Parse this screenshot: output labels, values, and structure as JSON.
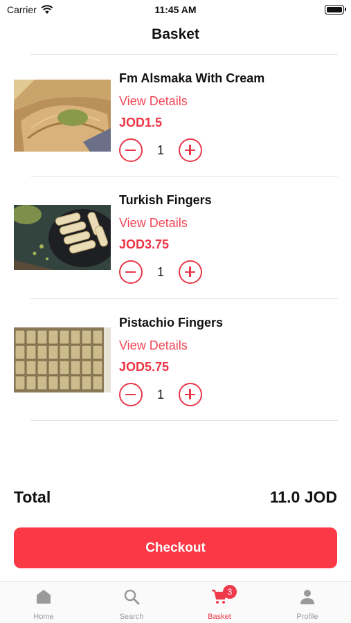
{
  "status_bar": {
    "carrier": "Carrier",
    "time": "11:45 AM"
  },
  "header": {
    "title": "Basket"
  },
  "items": [
    {
      "name": "Fm Alsmaka With Cream",
      "details_label": "View Details",
      "price": "JOD1.5",
      "quantity": "1"
    },
    {
      "name": "Turkish Fingers",
      "details_label": "View Details",
      "price": "JOD3.75",
      "quantity": "1"
    },
    {
      "name": "Pistachio Fingers",
      "details_label": "View Details",
      "price": "JOD5.75",
      "quantity": "1"
    }
  ],
  "summary": {
    "total_label": "Total",
    "total_value": "11.0 JOD"
  },
  "checkout_label": "Checkout",
  "tabs": [
    {
      "label": "Home",
      "icon": "home-icon"
    },
    {
      "label": "Search",
      "icon": "search-icon"
    },
    {
      "label": "Basket",
      "icon": "cart-icon",
      "badge": "3"
    },
    {
      "label": "Profile",
      "icon": "profile-icon"
    }
  ],
  "colors": {
    "accent": "#fb3846",
    "price": "#ec3444",
    "link": "#f04656",
    "tab_inactive": "#9a9a9a"
  }
}
